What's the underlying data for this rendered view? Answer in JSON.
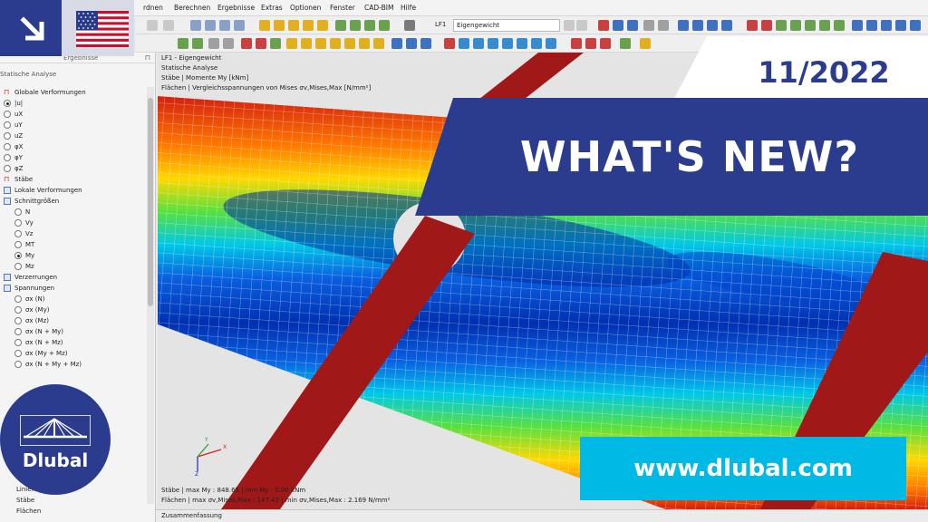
{
  "colors": {
    "brand_blue": "#2b3c8f",
    "url_cyan": "#00b9e4",
    "white": "#ffffff",
    "member_red": "#a01818"
  },
  "menu": {
    "items": [
      "rdnen",
      "Berechnen",
      "Ergebnisse",
      "Extras",
      "Optionen",
      "Fenster",
      "CAD-BIM",
      "Hilfe"
    ]
  },
  "toolbar": {
    "load_case": {
      "code": "LF1",
      "name": "Eigengewicht"
    }
  },
  "navigator": {
    "header": "Ergebnisse",
    "subheader": "Statische Analyse",
    "tree": [
      {
        "label": "Globale Verformungen",
        "kind": "group"
      },
      {
        "label": "|u|",
        "kind": "radio",
        "selected": true
      },
      {
        "label": "uX",
        "kind": "radio",
        "selected": false
      },
      {
        "label": "uY",
        "kind": "radio",
        "selected": false
      },
      {
        "label": "uZ",
        "kind": "radio",
        "selected": false
      },
      {
        "label": "φX",
        "kind": "radio",
        "selected": false
      },
      {
        "label": "φY",
        "kind": "radio",
        "selected": false
      },
      {
        "label": "φZ",
        "kind": "radio",
        "selected": false
      },
      {
        "label": "Stäbe",
        "kind": "section"
      },
      {
        "label": "Lokale Verformungen",
        "kind": "check"
      },
      {
        "label": "Schnittgrößen",
        "kind": "check"
      },
      {
        "label": "N",
        "kind": "radio",
        "selected": false
      },
      {
        "label": "Vy",
        "kind": "radio",
        "selected": false
      },
      {
        "label": "Vz",
        "kind": "radio",
        "selected": false
      },
      {
        "label": "MT",
        "kind": "radio",
        "selected": false
      },
      {
        "label": "My",
        "kind": "radio",
        "selected": true
      },
      {
        "label": "Mz",
        "kind": "radio",
        "selected": false
      },
      {
        "label": "Verzerrungen",
        "kind": "check"
      },
      {
        "label": "Spannungen",
        "kind": "check"
      },
      {
        "label": "σx (N)",
        "kind": "radio",
        "selected": false
      },
      {
        "label": "σx (My)",
        "kind": "radio",
        "selected": false
      },
      {
        "label": "σx (Mz)",
        "kind": "radio",
        "selected": false
      },
      {
        "label": "σx (N + My)",
        "kind": "radio",
        "selected": false
      },
      {
        "label": "σx (N + Mz)",
        "kind": "radio",
        "selected": false
      },
      {
        "label": "σx (My + Mz)",
        "kind": "radio",
        "selected": false
      },
      {
        "label": "σx (N + My + Mz)",
        "kind": "radio",
        "selected": false
      }
    ],
    "bottom_items": [
      "Linien",
      "Stäbe",
      "Flächen"
    ]
  },
  "viewport": {
    "lines_top": [
      "LF1 - Eigengewicht",
      "Statische Analyse",
      "Stäbe | Momente My [kNm]",
      "Flächen | Vergleichsspannungen von Mises σv,Mises,Max [N/mm²]"
    ],
    "lines_bottom": [
      "Stäbe | max My : 848.65 | min My : 0.00 kNm",
      "Flächen | max σv,Mises,Max : 147.42 | min σv,Mises,Max : 2.169 N/mm²"
    ],
    "axes": {
      "x": "X",
      "y": "Y",
      "z": "Z"
    }
  },
  "statusbar": {
    "label": "Zusammenfassung"
  },
  "promo": {
    "date": "11/2022",
    "headline": "WHAT'S NEW?",
    "url": "www.dlubal.com",
    "brand": "Dlubal",
    "icons": {
      "corner": "arrow-down-right-icon",
      "flag": "us-flag-icon",
      "logo": "dlubal-bridge-logo-icon"
    }
  }
}
